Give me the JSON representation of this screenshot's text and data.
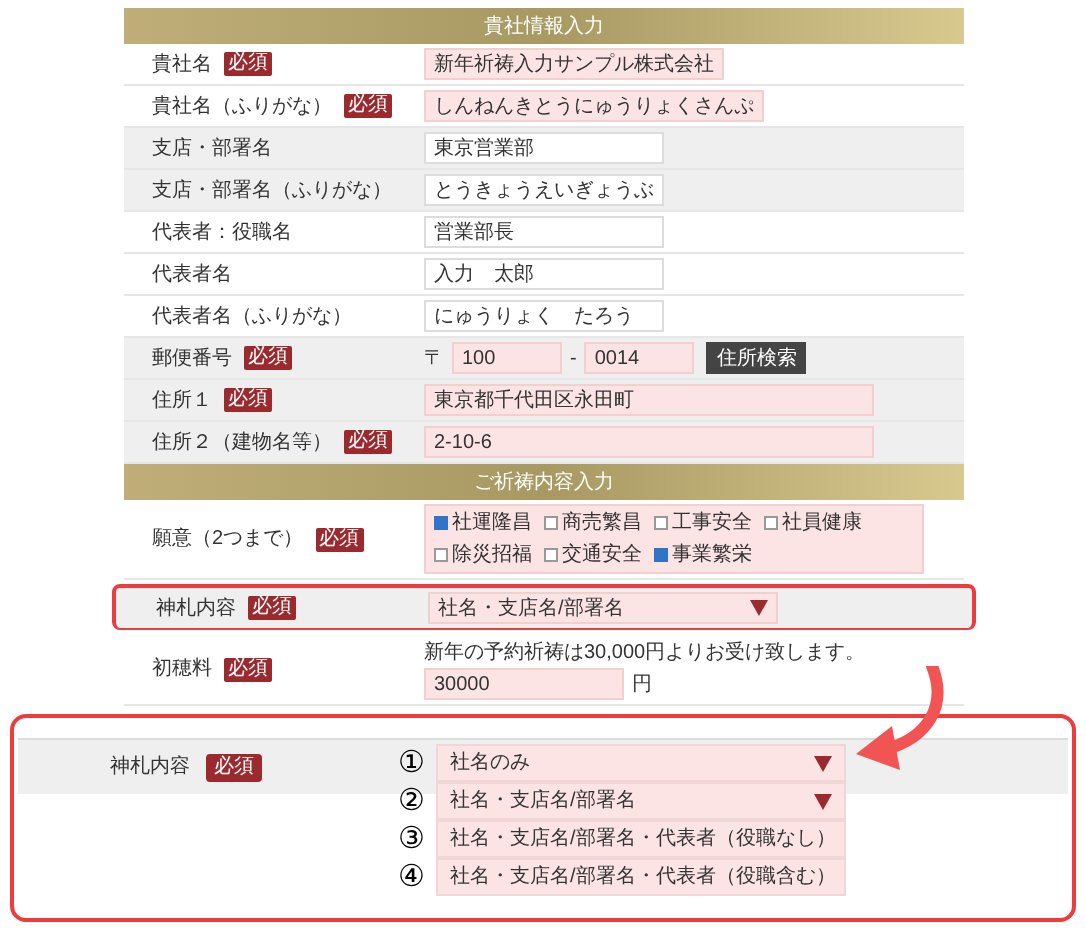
{
  "sections": [
    {
      "title": "貴社情報入力",
      "rows": [
        {
          "kind": "text",
          "label": "貴社名",
          "badge": "必須",
          "shaded": false,
          "value": "新年祈祷入力サンプル株式会社"
        },
        {
          "kind": "text",
          "label": "貴社名（ふりがな）",
          "badge": "必須",
          "shaded": false,
          "value": "しんねんきとうにゅうりょくさんぷ"
        },
        {
          "kind": "text",
          "label": "支店・部署名",
          "shaded": true,
          "value": "東京営業部"
        },
        {
          "kind": "text",
          "label": "支店・部署名（ふりがな）",
          "shaded": true,
          "value": "とうきょうえいぎょうぶ"
        },
        {
          "kind": "text",
          "label": "代表者：役職名",
          "shaded": false,
          "value": "営業部長"
        },
        {
          "kind": "text",
          "label": "代表者名",
          "shaded": false,
          "value": "入力　太郎"
        },
        {
          "kind": "text",
          "label": "代表者名（ふりがな）",
          "shaded": false,
          "value": "にゅうりょく　たろう"
        },
        {
          "kind": "postal",
          "label": "郵便番号",
          "badge": "必須",
          "shaded": true,
          "prefix": "〒",
          "first": "100",
          "separator": "-",
          "second": "0014",
          "button": "住所検索"
        },
        {
          "kind": "text",
          "label": "住所１",
          "badge": "必須",
          "shaded": true,
          "value": "東京都千代田区永田町",
          "wide": true
        },
        {
          "kind": "text",
          "label": "住所２（建物名等）",
          "badge": "必須",
          "shaded": true,
          "value": "2-10-6",
          "wide": true
        }
      ]
    },
    {
      "title": "ご祈祷内容入力",
      "rows": [
        {
          "kind": "checkboxes",
          "label": "願意（2つまで）",
          "badge": "必須",
          "shaded": false,
          "options": [
            {
              "label": "社運隆昌",
              "checked": true
            },
            {
              "label": "商売繁昌",
              "checked": false
            },
            {
              "label": "工事安全",
              "checked": false
            },
            {
              "label": "社員健康",
              "checked": false
            },
            {
              "label": "除災招福",
              "checked": false
            },
            {
              "label": "交通安全",
              "checked": false
            },
            {
              "label": "事業繁栄",
              "checked": true
            }
          ]
        },
        {
          "kind": "select",
          "label": "神札内容",
          "badge": "必須",
          "shaded": true,
          "highlighted": true,
          "value": "社名・支店名/部署名"
        },
        {
          "kind": "amount",
          "label": "初穂料",
          "badge": "必須",
          "shaded": false,
          "note": "新年の予約祈祷は30,000円よりお受け致します。",
          "value": "30000",
          "unit": "円"
        }
      ]
    }
  ],
  "callout": {
    "label": "神札内容",
    "badge": "必須",
    "options": [
      {
        "number": "①",
        "text": "社名のみ"
      },
      {
        "number": "②",
        "text": "社名・支店名/部署名"
      },
      {
        "number": "③",
        "text": "社名・支店名/部署名・代表者（役職なし）"
      },
      {
        "number": "④",
        "text": "社名・支店名/部署名・代表者（役職含む）"
      }
    ]
  }
}
